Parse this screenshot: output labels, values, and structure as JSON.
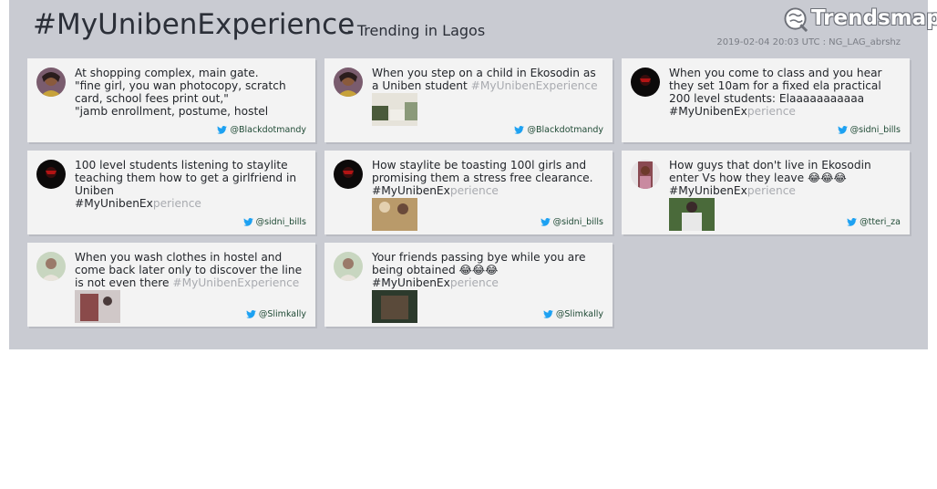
{
  "header": {
    "hashtag": "#MyUnibenExperience",
    "subtitle": "- Trending in Lagos",
    "brand": "Trendsmap",
    "meta": "2019-02-04 20:03 UTC : NG_LAG_abrshz"
  },
  "colors": {
    "panel": "#c9cbd2",
    "card": "#f3f3f3",
    "handle": "#1f4a35",
    "twitter": "#1da1f2"
  },
  "tweets": [
    {
      "text": "At shopping complex, main gate.\n\"fine girl, you wan photocopy, scratch card, school fees print out,\"\n\"jamb enrollment, postume, hostel",
      "fade": "",
      "handle": "@Blackdotmandy",
      "avatar": "woman-avatar",
      "thumb": false
    },
    {
      "text": "When you step on a child in Ekosodin as a Uniben student ",
      "fade": "#MyUnibenExperience",
      "handle": "@Blackdotmandy",
      "avatar": "woman-avatar",
      "thumb": true
    },
    {
      "text": "When you come to class and you hear they set 10am for a fixed ela practical 200 level students: Elaaaaaaaaaaa\n#MyUnibenEx",
      "fade": "perience",
      "handle": "@sidni_bills",
      "avatar": "dark-avatar",
      "thumb": false
    },
    {
      "text": "100 level students listening to staylite teaching them how to get a girlfriend in Uniben\n#MyUnibenEx",
      "fade": "perience",
      "handle": "@sidni_bills",
      "avatar": "dark-avatar",
      "thumb": false
    },
    {
      "text": "How staylite be toasting 100l girls and promising them a stress free clearance.\n#MyUnibenEx",
      "fade": "perience",
      "handle": "@sidni_bills",
      "avatar": "dark-avatar",
      "thumb": true
    },
    {
      "text": "How guys that don't live in Ekosodin enter Vs how they leave 😂😂😂\n#MyUnibenEx",
      "fade": "perience",
      "handle": "@tteri_za",
      "avatar": "girl-avatar",
      "thumb": true
    },
    {
      "text": "When you wash clothes in hostel and come back later only to discover the line is not even there ",
      "fade": "#MyUnibenExperience",
      "handle": "@Slimkally",
      "avatar": "man-avatar",
      "thumb": true
    },
    {
      "text": "Your friends passing bye while you are being obtained 😂😂😂\n#MyUnibenEx",
      "fade": "perience",
      "handle": "@Slimkally",
      "avatar": "man-avatar",
      "thumb": true
    }
  ]
}
